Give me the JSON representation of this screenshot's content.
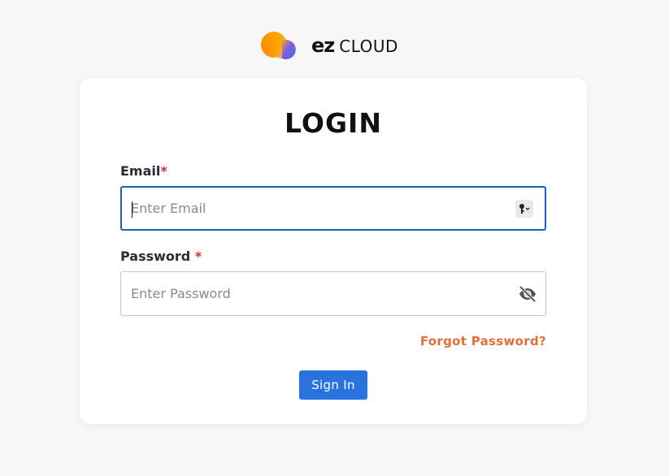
{
  "brand": {
    "logo_icon": "ez-cloud-logo-icon",
    "name_ez": "ez",
    "name_cloud": "CLOUD",
    "colors": {
      "orange": "#f7941d",
      "purple": "#6a4bd8",
      "blue": "#3a7bd5"
    }
  },
  "login": {
    "title": "LOGIN",
    "email": {
      "label": "Email",
      "required_marker": "*",
      "placeholder": "Enter Email",
      "value": "",
      "icon": "key-autofill-icon"
    },
    "password": {
      "label": "Password",
      "required_marker": "*",
      "placeholder": "Enter Password",
      "value": "",
      "icon": "eye-slash-icon"
    },
    "forgot_password": "Forgot Password?",
    "submit_label": "Sign In"
  },
  "colors": {
    "background": "#f7f7f7",
    "card": "#ffffff",
    "focus_border": "#1e5fb8",
    "required": "#d32f2f",
    "link": "#e0703a",
    "primary_button": "#2a73de"
  }
}
